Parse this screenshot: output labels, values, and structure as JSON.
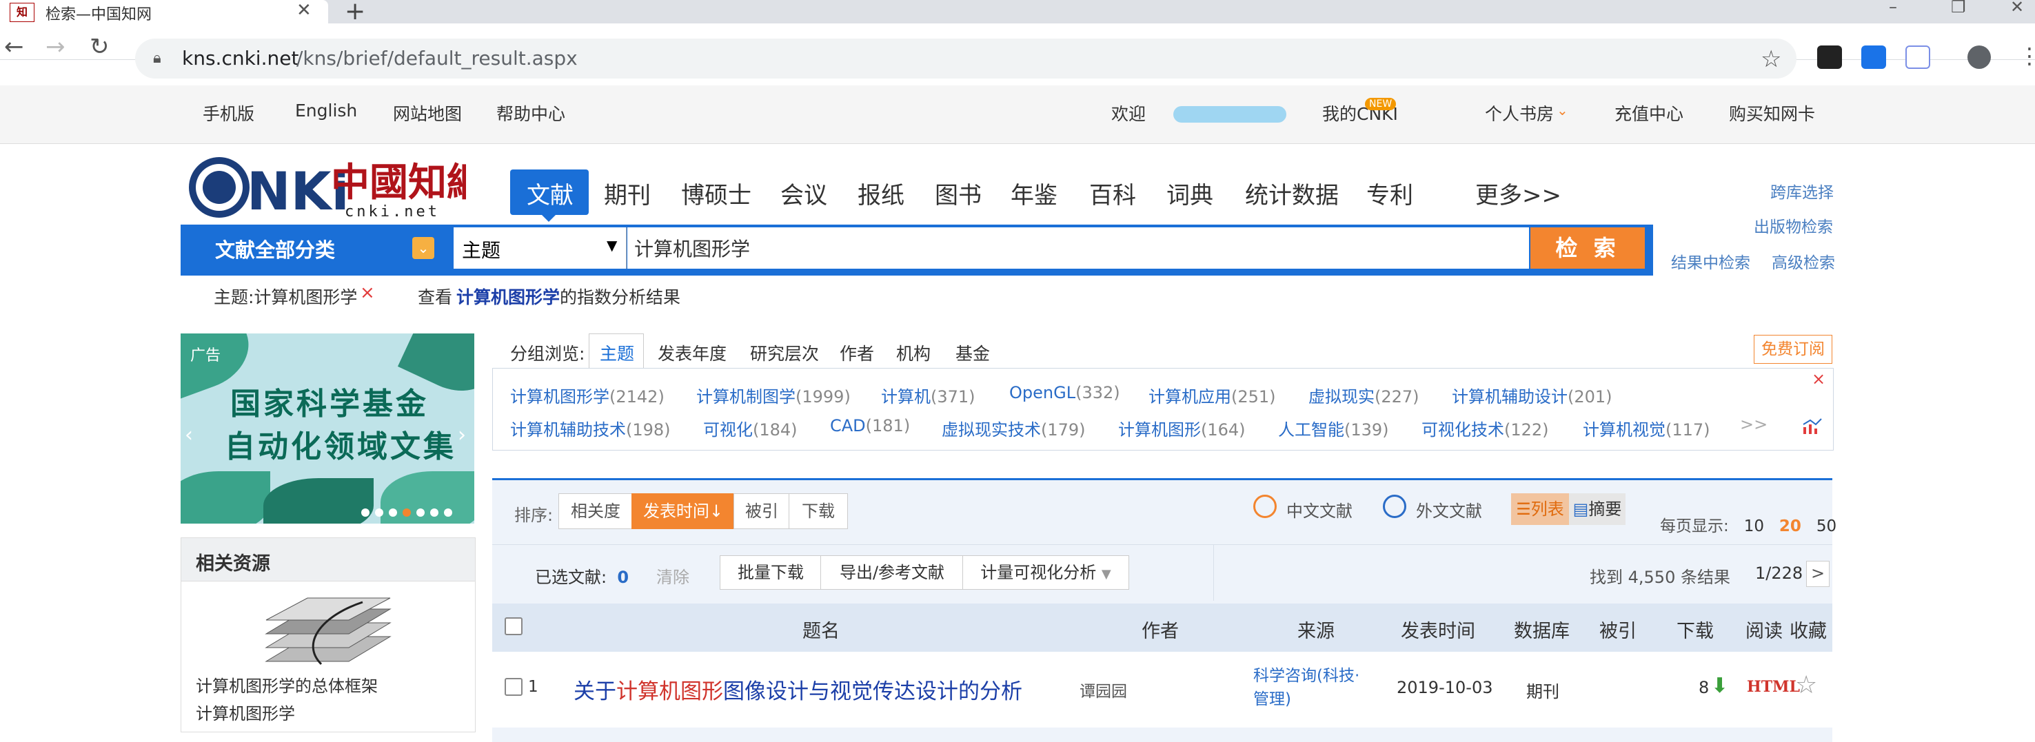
{
  "browser": {
    "tab_title": "检索—中国知网",
    "favicon_text": "知",
    "url_host": "kns.cnki.net",
    "url_path": "/kns/brief/default_result.aspx"
  },
  "topbar": {
    "left_links": [
      "手机版",
      "English",
      "网站地图",
      "帮助中心"
    ],
    "welcome": "欢迎",
    "my_cnki": "我的CNKI",
    "new_badge": "NEW",
    "bookshelf": "个人书房",
    "recharge": "充值中心",
    "buy_card": "购买知网卡"
  },
  "logo": {
    "sub": "cnki.net"
  },
  "nav": {
    "tabs": [
      "文献",
      "期刊",
      "博硕士",
      "会议",
      "报纸",
      "图书",
      "年鉴",
      "百科",
      "词典",
      "统计数据",
      "专利",
      "更多>>"
    ],
    "active": "文献"
  },
  "right_links": {
    "cross_db": "跨库选择",
    "pub_search": "出版物检索",
    "in_result": "结果中检索",
    "advanced": "高级检索"
  },
  "search": {
    "category_label": "文献全部分类",
    "field": "主题",
    "query": "计算机图形学",
    "button": "检 索"
  },
  "filter": {
    "tag": "主题:计算机图形学",
    "remove": "×",
    "view_prefix": "查看",
    "view_term": "计算机图形学",
    "view_suffix": "的指数分析结果"
  },
  "ad": {
    "badge": "广告",
    "line1": "国家科学基金",
    "line2": "自动化领域文集"
  },
  "related": {
    "title": "相关资源",
    "caption": "计算机图形学的总体框架",
    "sub": "计算机图形学"
  },
  "group": {
    "label": "分组浏览:",
    "tabs": [
      "主题",
      "发表年度",
      "研究层次",
      "作者",
      "机构",
      "基金"
    ],
    "subscribe": "免费订阅",
    "row1": [
      {
        "name": "计算机图形学",
        "count": "(2142)"
      },
      {
        "name": "计算机制图学",
        "count": "(1999)"
      },
      {
        "name": "计算机",
        "count": "(371)"
      },
      {
        "name": "OpenGL",
        "count": "(332)"
      },
      {
        "name": "计算机应用",
        "count": "(251)"
      },
      {
        "name": "虚拟现实",
        "count": "(227)"
      },
      {
        "name": "计算机辅助设计",
        "count": "(201)"
      }
    ],
    "row2": [
      {
        "name": "计算机辅助技术",
        "count": "(198)"
      },
      {
        "name": "可视化",
        "count": "(184)"
      },
      {
        "name": "CAD",
        "count": "(181)"
      },
      {
        "name": "虚拟现实技术",
        "count": "(179)"
      },
      {
        "name": "计算机图形",
        "count": "(164)"
      },
      {
        "name": "人工智能",
        "count": "(139)"
      },
      {
        "name": "可视化技术",
        "count": "(122)"
      },
      {
        "name": "计算机视觉",
        "count": "(117)"
      }
    ],
    "more": ">>",
    "close": "×"
  },
  "results": {
    "sort_label": "排序:",
    "sort_options": [
      "相关度",
      "发表时间",
      "被引",
      "下载"
    ],
    "zh_lit": "中文文献",
    "en_lit": "外文文献",
    "view_list": "列表",
    "view_abstract": "摘要",
    "per_page_label": "每页显示:",
    "per_page": [
      "10",
      "20",
      "50"
    ],
    "selected_label": "已选文献:",
    "selected_count": "0",
    "clear": "清除",
    "actions": [
      "批量下载",
      "导出/参考文献",
      "计量可视化分析"
    ],
    "found": "找到 4,550 条结果",
    "pager": "1/228",
    "next": ">"
  },
  "table": {
    "headers": [
      "题名",
      "作者",
      "来源",
      "发表时间",
      "数据库",
      "被引",
      "下载",
      "阅读",
      "收藏"
    ],
    "rows": [
      {
        "num": "1",
        "title_pre": "关于",
        "title_hl": "计算机图形",
        "title_post": "图像设计与视觉传达设计的分析",
        "author": "谭园园",
        "source_l1": "科学咨询(科技·",
        "source_l2": "管理)",
        "date": "2019-10-03",
        "db": "期刊",
        "cited": "",
        "downloads": "8",
        "read": "HTML"
      }
    ]
  },
  "colors": {
    "brand_blue": "#1a6fd7",
    "accent_orange": "#f3852f",
    "highlight_red": "#d0342c"
  }
}
